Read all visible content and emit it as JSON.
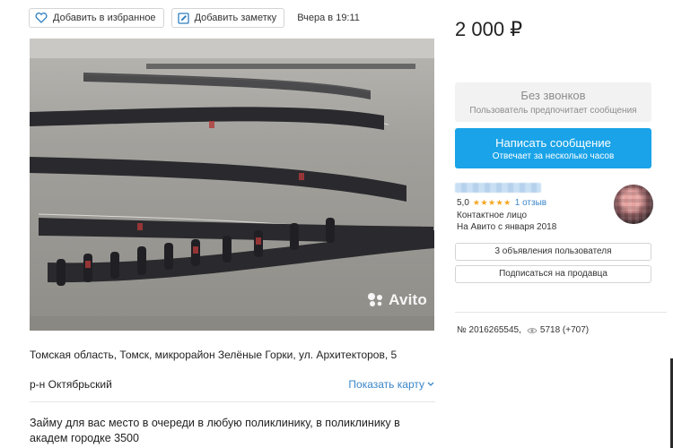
{
  "toolbar": {
    "favorite_label": "Добавить в избранное",
    "note_label": "Добавить заметку",
    "posted": "Вчера в 19:11"
  },
  "photo": {
    "watermark": "Avito"
  },
  "location": {
    "address": "Томская область, Томск, микрорайон Зелёные Горки, ул. Архитекторов, 5",
    "district": "р-н Октябрьский",
    "map_link": "Показать карту"
  },
  "description": "Займу для вас место в очереди в любую поликлинику, в поликлинику в академ городке 3500",
  "sidebar": {
    "price": "2 000 ₽",
    "no_calls_title": "Без звонков",
    "no_calls_sub": "Пользователь предпочитает сообщения",
    "message_title": "Написать сообщение",
    "message_sub": "Отвечает за несколько часов",
    "rating_value": "5,0",
    "stars": "★★★★★",
    "reviews": "1 отзыв",
    "contact": "Контактное лицо",
    "since": "На Авито с января 2018",
    "ads_button": "3 объявления пользователя",
    "subscribe_button": "Подписаться на продавца",
    "ad_number": "№ 2016265545,",
    "views": "5718 (+707)"
  },
  "colors": {
    "accent": "#1aa3e8",
    "link": "#3a86c8",
    "star": "#f5a623"
  }
}
